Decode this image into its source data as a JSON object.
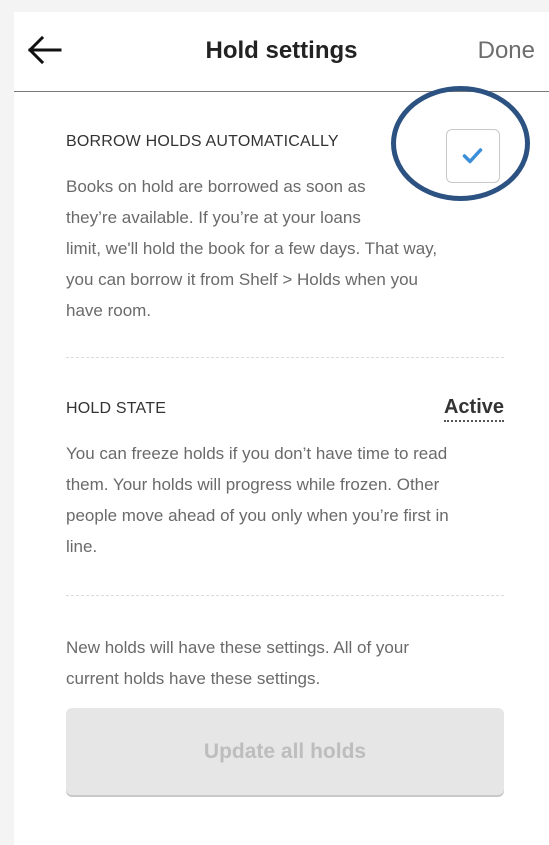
{
  "header": {
    "title": "Hold settings",
    "done_label": "Done"
  },
  "borrow": {
    "label": "BORROW HOLDS AUTOMATICALLY",
    "checked": true,
    "description_lines": [
      "Books on hold are borrowed as soon as",
      "they’re available. If you’re at your loans",
      "limit, we'll hold the book for a few days. That way,",
      "you can borrow it from Shelf > Holds when you",
      "have room."
    ]
  },
  "hold_state": {
    "label": "HOLD STATE",
    "value": "Active",
    "description_lines": [
      "You can freeze holds if you don’t have time to read",
      "them. Your holds will progress while frozen. Other",
      "people move ahead of you only when you’re first in",
      "line."
    ]
  },
  "footer": {
    "note_lines": [
      "New holds will have these settings. All of your",
      "current holds have these settings."
    ],
    "update_button": "Update all holds"
  },
  "colors": {
    "checkmark": "#3a8fd8",
    "highlight_ring": "#2c5282"
  },
  "icons": {
    "back": "arrow-left-icon",
    "check": "checkmark-icon"
  }
}
